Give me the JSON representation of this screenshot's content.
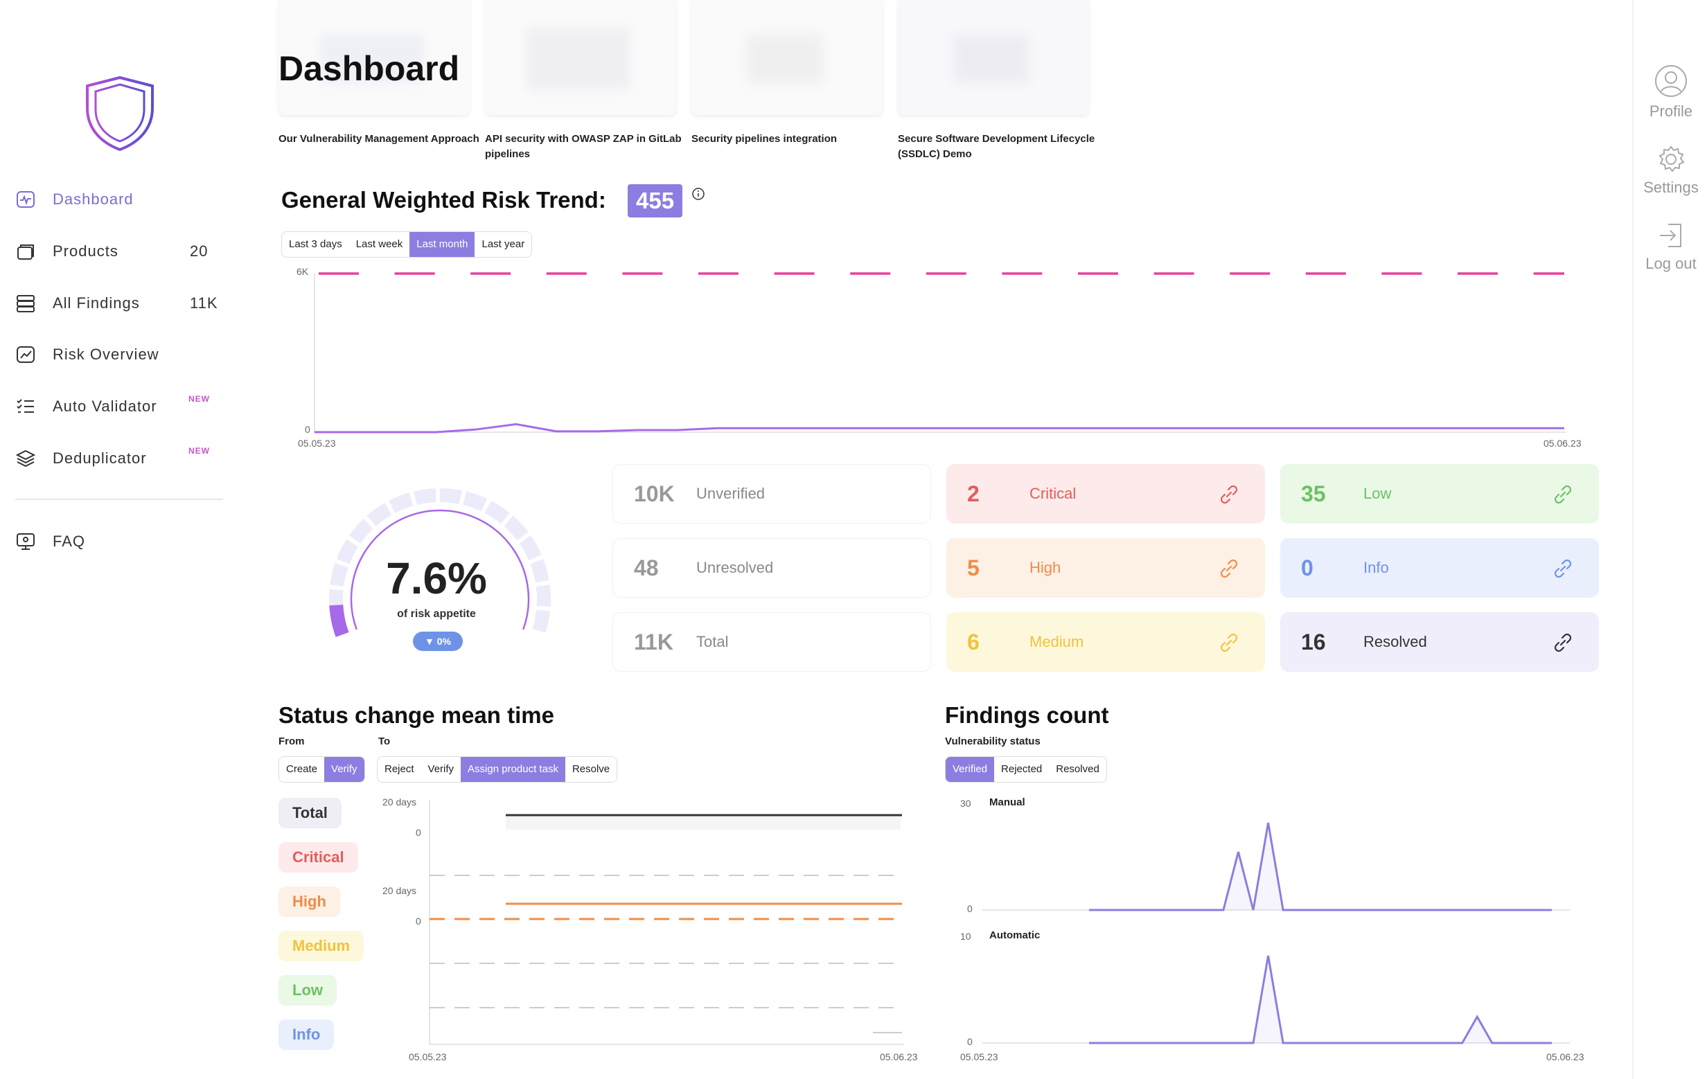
{
  "sidebar": {
    "items": [
      {
        "label": "Dashboard",
        "count": ""
      },
      {
        "label": "Products",
        "count": "20"
      },
      {
        "label": "All Findings",
        "count": "11K"
      },
      {
        "label": "Risk Overview",
        "count": ""
      },
      {
        "label": "Auto Validator",
        "count": "",
        "badge": "NEW"
      },
      {
        "label": "Deduplicator",
        "count": "",
        "badge": "NEW"
      }
    ],
    "faq": "FAQ"
  },
  "rightbar": {
    "profile": "Profile",
    "settings": "Settings",
    "logout": "Log out"
  },
  "page_title": "Dashboard",
  "thumbnails": [
    "Our Vulnerability Management Approach",
    "API security with OWASP ZAP in GitLab pipelines",
    "Security pipelines integration",
    "Secure Software Development Lifecycle (SSDLC) Demo"
  ],
  "risk_trend": {
    "title": "General Weighted Risk Trend:",
    "value": "455",
    "ranges": [
      "Last 3 days",
      "Last week",
      "Last month",
      "Last year"
    ],
    "selected_range": "Last month",
    "y_top_label": "6K",
    "y_zero_label": "0",
    "x_start": "05.05.23",
    "x_end": "05.06.23"
  },
  "chart_data": [
    {
      "type": "line",
      "title": "General Weighted Risk Trend",
      "x": [
        "05.05.23",
        "",
        "",
        "",
        "",
        "",
        "",
        "",
        "",
        "",
        "",
        "",
        "",
        "",
        "",
        "",
        "",
        "",
        "",
        "",
        "",
        "",
        "",
        "",
        "",
        "",
        "",
        "",
        "",
        "",
        "",
        "05.06.23"
      ],
      "series": [
        {
          "values": [
            0,
            0,
            0,
            0,
            100,
            300,
            30,
            30,
            80,
            80,
            150,
            150,
            150,
            150,
            150,
            150,
            150,
            150,
            150,
            150,
            150,
            150,
            150,
            150,
            150,
            150,
            150,
            150,
            150,
            150,
            150,
            150
          ]
        }
      ],
      "threshold": 6000,
      "ylim": [
        0,
        6000
      ],
      "grid": false
    },
    {
      "type": "line",
      "title": "Findings count",
      "panels": [
        {
          "name": "Manual",
          "ylim": [
            0,
            30
          ],
          "values": [
            0,
            0,
            0,
            0,
            0,
            0,
            0,
            0,
            0,
            0,
            20,
            0,
            30,
            0,
            0,
            0,
            0,
            0,
            0,
            0,
            0,
            0,
            0,
            0,
            0,
            0,
            0,
            0,
            0,
            0,
            0,
            0
          ]
        },
        {
          "name": "Automatic",
          "ylim": [
            0,
            10
          ],
          "values": [
            0,
            0,
            0,
            0,
            0,
            0,
            0,
            0,
            0,
            0,
            0,
            0,
            10,
            0,
            0,
            0,
            0,
            0,
            0,
            0,
            0,
            0,
            0,
            0,
            0,
            0,
            3,
            0,
            0,
            0,
            0,
            0
          ]
        }
      ],
      "x_start": "05.05.23",
      "x_end": "05.06.23"
    }
  ],
  "gauge": {
    "percent": "7.6%",
    "caption": "of risk appetite",
    "delta": "0%",
    "fill_fraction": 0.076
  },
  "stats": {
    "unverified": {
      "n": "10K",
      "label": "Unverified"
    },
    "unresolved": {
      "n": "48",
      "label": "Unresolved"
    },
    "total": {
      "n": "11K",
      "label": "Total"
    },
    "critical": {
      "n": "2",
      "label": "Critical"
    },
    "high": {
      "n": "5",
      "label": "High"
    },
    "medium": {
      "n": "6",
      "label": "Medium"
    },
    "low": {
      "n": "35",
      "label": "Low"
    },
    "info": {
      "n": "0",
      "label": "Info"
    },
    "resolved": {
      "n": "16",
      "label": "Resolved"
    }
  },
  "status_change": {
    "title": "Status change mean time",
    "from_label": "From",
    "to_label": "To",
    "from_options": [
      "Create",
      "Verify"
    ],
    "from_selected": "Verify",
    "to_options": [
      "Reject",
      "Verify",
      "Assign product task",
      "Resolve"
    ],
    "to_selected": "Assign product task",
    "severity_badges": [
      "Total",
      "Critical",
      "High",
      "Medium",
      "Low",
      "Info"
    ],
    "y_label_top": "20 days",
    "y_zero": "0",
    "x_start": "05.05.23",
    "x_end": "05.06.23"
  },
  "findings_count": {
    "title": "Findings count",
    "subtitle": "Vulnerability status",
    "options": [
      "Verified",
      "Rejected",
      "Resolved"
    ],
    "selected": "Verified",
    "manual_label": "Manual",
    "automatic_label": "Automatic",
    "manual_top": "30",
    "automatic_top": "10",
    "zero": "0",
    "x_start": "05.05.23",
    "x_end": "05.06.23"
  },
  "colors": {
    "accent": "#8b7ee0",
    "threshold": "#e8409a",
    "critical": "#e35d5d",
    "high": "#ef8c4a",
    "medium": "#f0c33c",
    "low": "#6cc164",
    "info": "#6e93e6"
  }
}
